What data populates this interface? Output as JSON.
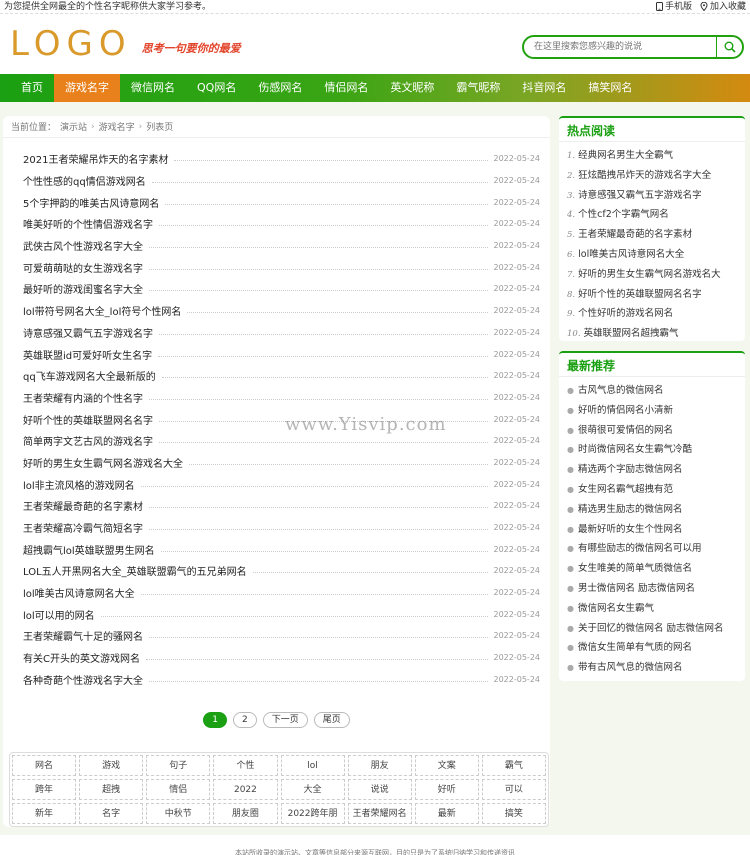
{
  "topbar": {
    "notice": "为您提供全网最全的个性名字昵称供大家学习参考。",
    "mobile_label": "手机版",
    "favorite_label": "加入收藏"
  },
  "header": {
    "logo": "LOGO",
    "slogan": "思考一句要你的最爱"
  },
  "search": {
    "placeholder": "在这里搜索您感兴趣的说说"
  },
  "nav": {
    "items": [
      "首页",
      "游戏名字",
      "微信网名",
      "QQ网名",
      "伤感网名",
      "情侣网名",
      "英文昵称",
      "霸气昵称",
      "抖音网名",
      "搞笑网名"
    ],
    "active_index": 1
  },
  "breadcrumb": {
    "prefix": "当前位置：",
    "items": [
      "演示站",
      "游戏名字",
      "列表页"
    ]
  },
  "list": [
    {
      "title": "2021王者荣耀吊炸天的名字素材",
      "date": "2022-05-24"
    },
    {
      "title": "个性性感的qq情侣游戏网名",
      "date": "2022-05-24"
    },
    {
      "title": "5个字押韵的唯美古风诗意网名",
      "date": "2022-05-24"
    },
    {
      "title": "唯美好听的个性情侣游戏名字",
      "date": "2022-05-24"
    },
    {
      "title": "武侠古风个性游戏名字大全",
      "date": "2022-05-24"
    },
    {
      "title": "可爱萌萌哒的女生游戏名字",
      "date": "2022-05-24"
    },
    {
      "title": "最好听的游戏闺蜜名字大全",
      "date": "2022-05-24"
    },
    {
      "title": "lol带符号网名大全_lol符号个性网名",
      "date": "2022-05-24"
    },
    {
      "title": "诗意感强又霸气五字游戏名字",
      "date": "2022-05-24"
    },
    {
      "title": "英雄联盟id可爱好听女生名字",
      "date": "2022-05-24"
    },
    {
      "title": "qq飞车游戏网名大全最新版的",
      "date": "2022-05-24"
    },
    {
      "title": "王者荣耀有内涵的个性名字",
      "date": "2022-05-24"
    },
    {
      "title": "好听个性的英雄联盟网名名字",
      "date": "2022-05-24"
    },
    {
      "title": "简单两字文艺古风的游戏名字",
      "date": "2022-05-24"
    },
    {
      "title": "好听的男生女生霸气网名游戏名大全",
      "date": "2022-05-24"
    },
    {
      "title": "lol非主流风格的游戏网名",
      "date": "2022-05-24"
    },
    {
      "title": "王者荣耀最奇葩的名字素材",
      "date": "2022-05-24"
    },
    {
      "title": "王者荣耀高冷霸气简短名字",
      "date": "2022-05-24"
    },
    {
      "title": "超拽霸气lol英雄联盟男生网名",
      "date": "2022-05-24"
    },
    {
      "title": "LOL五人开黑网名大全_英雄联盟霸气的五兄弟网名",
      "date": "2022-05-24"
    },
    {
      "title": "lol唯美古风诗意网名大全",
      "date": "2022-05-24"
    },
    {
      "title": "lol可以用的网名",
      "date": "2022-05-24"
    },
    {
      "title": "王者荣耀霸气十足的骚网名",
      "date": "2022-05-24"
    },
    {
      "title": "有关C开头的英文游戏网名",
      "date": "2022-05-24"
    },
    {
      "title": "各种奇葩个性游戏名字大全",
      "date": "2022-05-24"
    }
  ],
  "pager": {
    "current": "1",
    "page2": "2",
    "next": "下一页",
    "last": "尾页"
  },
  "tags": [
    "网名",
    "游戏",
    "句子",
    "个性",
    "lol",
    "朋友",
    "文案",
    "霸气",
    "跨年",
    "超拽",
    "情侣",
    "2022",
    "大全",
    "说说",
    "好听",
    "可以",
    "新年",
    "名字",
    "中秋节",
    "朋友圈",
    "2022跨年朋",
    "王者荣耀网名",
    "最新",
    "搞笑"
  ],
  "hot": {
    "title": "热点阅读",
    "items": [
      "经典网名男生大全霸气",
      "狂炫酷拽吊炸天的游戏名字大全",
      "诗意感强又霸气五字游戏名字",
      "个性cf2个字霸气网名",
      "王者荣耀最奇葩的名字素材",
      "lol唯美古风诗意网名大全",
      "好听的男生女生霸气网名游戏名大",
      "好听个性的英雄联盟网名名字",
      "个性好听的游戏名网名",
      "英雄联盟网名超拽霸气"
    ]
  },
  "latest": {
    "title": "最新推荐",
    "items": [
      "古风气息的微信网名",
      "好听的情侣网名小清新",
      "很萌很可爱情侣的网名",
      "时尚微信网名女生霸气冷酷",
      "精选两个字励志微信网名",
      "女生网名霸气超拽有范",
      "精选男生励志的微信网名",
      "最新好听的女生个性网名",
      "有哪些励志的微信网名可以用",
      "女生唯美的简单气质微信名",
      "男士微信网名 励志微信网名",
      "微信网名女生霸气",
      "关于回忆的微信网名 励志微信网名",
      "微信女生简单有气质的网名",
      "带有古风气息的微信网名"
    ]
  },
  "watermark": "www.Yisvip.com",
  "footer": "本站所收录的演示站、文章等信息部分来源互联网，目的只是为了系统归纳学习和传递资讯",
  "colors": {
    "brand_green": "#1aa012",
    "nav_active": "#e8801c",
    "logo": "#d99a2b"
  }
}
